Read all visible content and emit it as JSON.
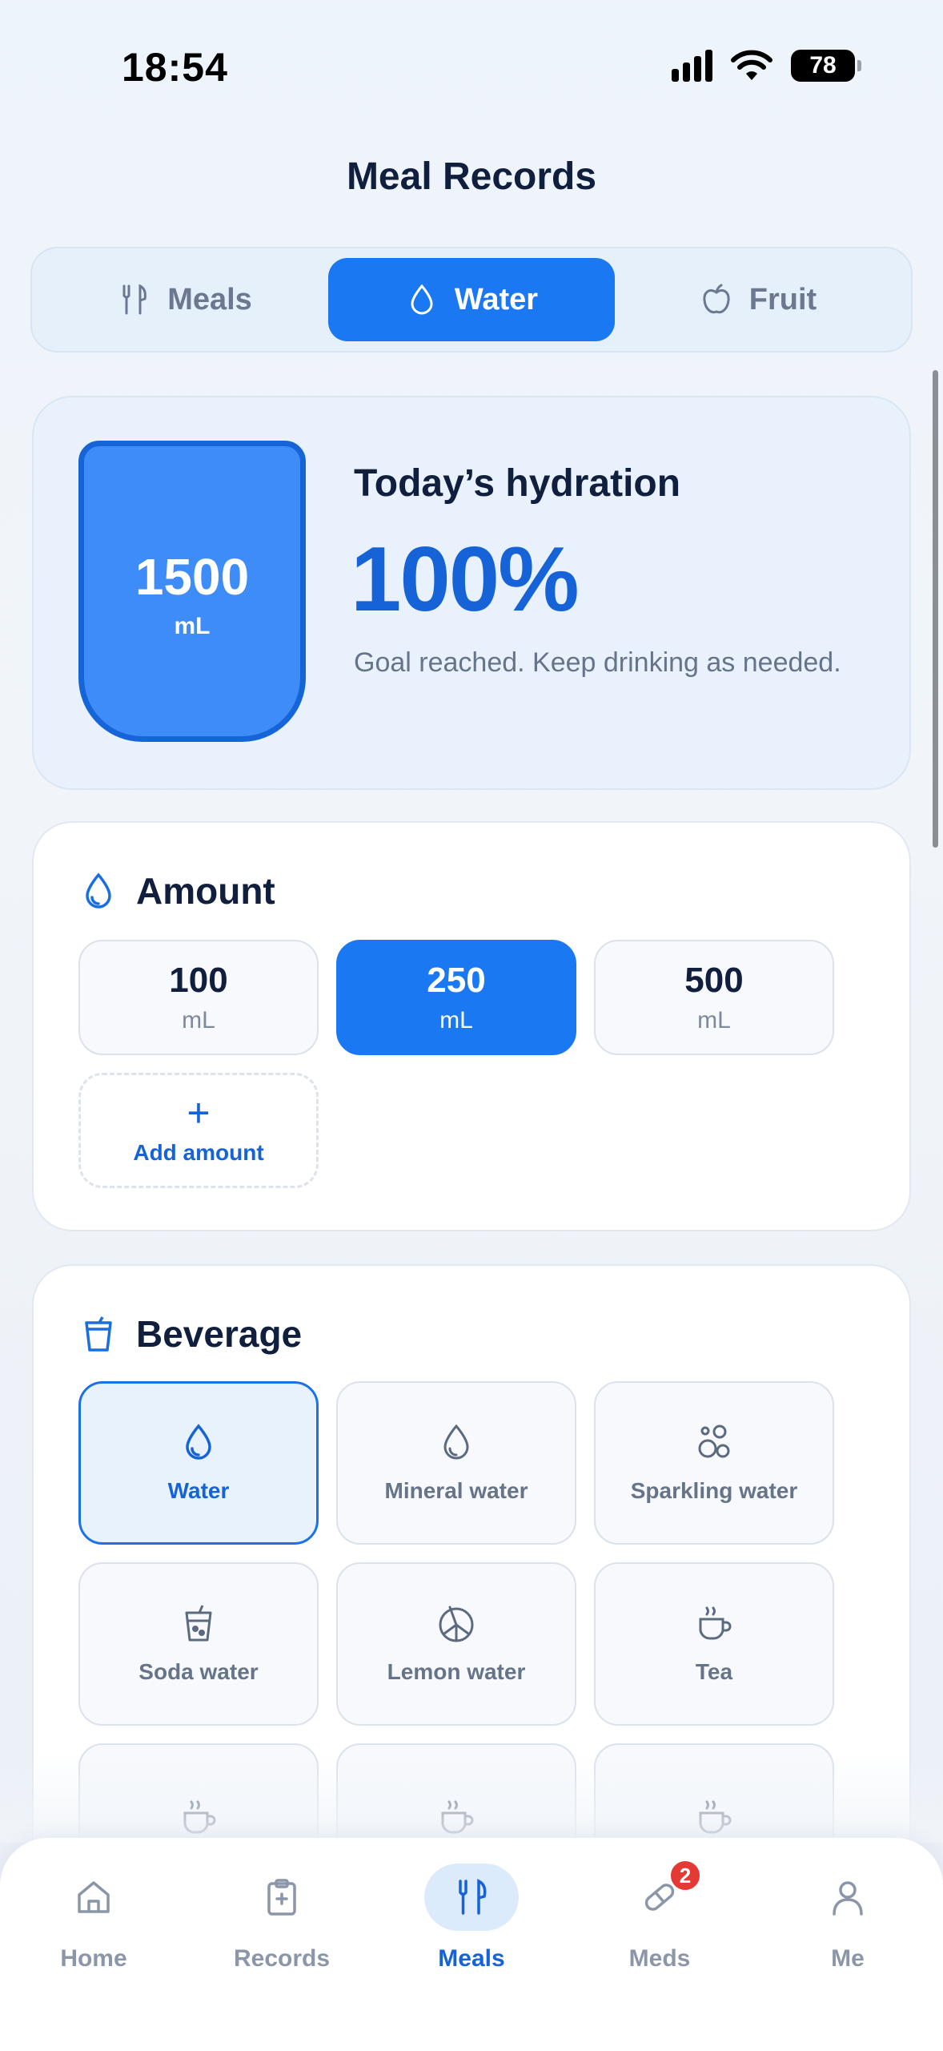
{
  "status": {
    "time": "18:54",
    "battery": "78"
  },
  "page": {
    "title": "Meal Records"
  },
  "tabs": [
    {
      "label": "Meals",
      "icon": "utensils-icon"
    },
    {
      "label": "Water",
      "icon": "droplet-icon",
      "active": true
    },
    {
      "label": "Fruit",
      "icon": "apple-icon"
    }
  ],
  "hydration": {
    "cup_value": "1500",
    "cup_unit": "mL",
    "title": "Today’s hydration",
    "percent": "100%",
    "note": "Goal reached. Keep drinking as needed."
  },
  "amount": {
    "title": "Amount",
    "options": [
      {
        "value": "100",
        "unit": "mL"
      },
      {
        "value": "250",
        "unit": "mL",
        "active": true
      },
      {
        "value": "500",
        "unit": "mL"
      }
    ],
    "add_plus": "+",
    "add_label": "Add amount"
  },
  "beverage": {
    "title": "Beverage",
    "items": [
      {
        "label": "Water",
        "icon": "droplet-icon",
        "active": true
      },
      {
        "label": "Mineral water",
        "icon": "droplet-outline-icon"
      },
      {
        "label": "Sparkling water",
        "icon": "bubbles-icon"
      },
      {
        "label": "Soda water",
        "icon": "soda-cup-icon"
      },
      {
        "label": "Lemon water",
        "icon": "lemon-slice-icon"
      },
      {
        "label": "Tea",
        "icon": "tea-cup-icon"
      },
      {
        "label": "",
        "icon": "hot-drink-icon"
      },
      {
        "label": "",
        "icon": "hot-drink-icon"
      },
      {
        "label": "",
        "icon": "hot-drink-icon"
      }
    ]
  },
  "tabbar": {
    "items": [
      {
        "label": "Home",
        "icon": "home-icon"
      },
      {
        "label": "Records",
        "icon": "clipboard-icon"
      },
      {
        "label": "Meals",
        "icon": "utensils-icon",
        "active": true
      },
      {
        "label": "Meds",
        "icon": "pill-icon",
        "badge": "2"
      },
      {
        "label": "Me",
        "icon": "user-icon"
      }
    ]
  },
  "colors": {
    "accent": "#1a78f2",
    "accent_dark": "#1563d6",
    "badge": "#e53935"
  }
}
